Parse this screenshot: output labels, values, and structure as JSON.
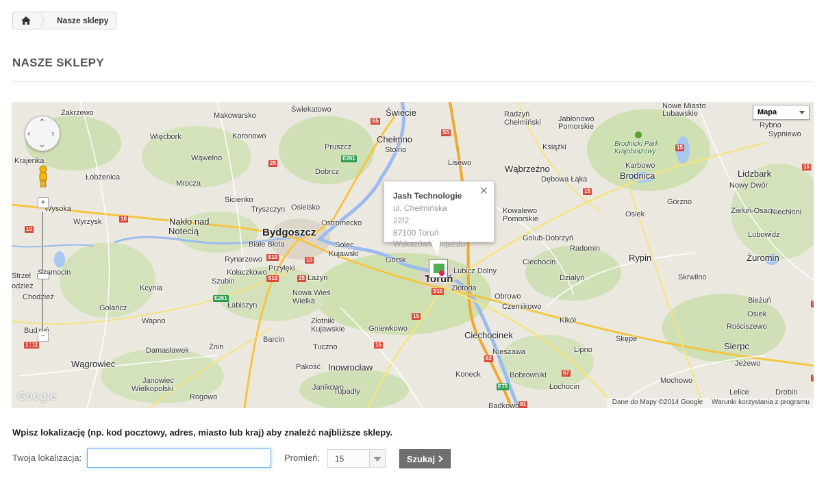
{
  "breadcrumb": {
    "home_icon": "home-icon",
    "current": "Nasze sklepy"
  },
  "page_title": "Nasze sklepy",
  "map": {
    "type_select": "Mapa",
    "info_window": {
      "name": "Jash Technologie",
      "address_line1": "ul. Chełmińska",
      "address_line2": "22/2",
      "address_line3": "87100 Toruń",
      "directions": "Wskazówki dojazdu"
    },
    "google_logo": "Google",
    "attribution": "Dane do Mapy ©2014 Google",
    "terms": "Warunki korzystania z programu",
    "labels": [
      {
        "t": "Zakrzewo",
        "c": "label"
      },
      {
        "t": "Makowarsko",
        "c": "label"
      },
      {
        "t": "Świekatowo",
        "c": "label"
      },
      {
        "t": "Świecie",
        "c": "label town"
      },
      {
        "t": "Radzyń",
        "c": "label"
      },
      {
        "t": "Chełmiński",
        "c": "label"
      },
      {
        "t": "Jabłonowo",
        "c": "label"
      },
      {
        "t": "Pomorskie",
        "c": "label"
      },
      {
        "t": "Nowe Miasto",
        "c": "label"
      },
      {
        "t": "Lubawskie",
        "c": "label"
      },
      {
        "t": "Rybno",
        "c": "label"
      },
      {
        "t": "Sypniewo",
        "c": "label"
      },
      {
        "t": "Więcbork",
        "c": "label"
      },
      {
        "t": "Koronowo",
        "c": "label"
      },
      {
        "t": "Chełmno",
        "c": "label town"
      },
      {
        "t": "Pruszcz",
        "c": "label"
      },
      {
        "t": "Stolno",
        "c": "label"
      },
      {
        "t": "Książki",
        "c": "label"
      },
      {
        "t": "Brodnicki Park",
        "c": "label park"
      },
      {
        "t": "Krajobrazowy",
        "c": "label park"
      },
      {
        "t": "Krajenka",
        "c": "label"
      },
      {
        "t": "Wąwelno",
        "c": "label"
      },
      {
        "t": "Lisewo",
        "c": "label"
      },
      {
        "t": "Wąbrzeźno",
        "c": "label town"
      },
      {
        "t": "Karbowo",
        "c": "label"
      },
      {
        "t": "Łobżenica",
        "c": "label"
      },
      {
        "t": "Mrocza",
        "c": "label"
      },
      {
        "t": "Dobrcz",
        "c": "label"
      },
      {
        "t": "Dębowa Łąka",
        "c": "label"
      },
      {
        "t": "Brodnica",
        "c": "label town"
      },
      {
        "t": "Lidzbark",
        "c": "label town"
      },
      {
        "t": "Nowy Dwór",
        "c": "label"
      },
      {
        "t": "Tryszczyn",
        "c": "label"
      },
      {
        "t": "Sicienko",
        "c": "label"
      },
      {
        "t": "Osielsko",
        "c": "label"
      },
      {
        "t": "Górzno",
        "c": "label"
      },
      {
        "t": "Wysoka",
        "c": "label"
      },
      {
        "t": "Kowalewo",
        "c": "label"
      },
      {
        "t": "Pomorskie",
        "c": "label"
      },
      {
        "t": "Osiek",
        "c": "label"
      },
      {
        "t": "Zieluń-Osada",
        "c": "label"
      },
      {
        "t": "Niechłoni",
        "c": "label"
      },
      {
        "t": "Wyrzysk",
        "c": "label"
      },
      {
        "t": "Nakło nad",
        "c": "label town"
      },
      {
        "t": "Notecią",
        "c": "label town"
      },
      {
        "t": "Ostromecko",
        "c": "label"
      },
      {
        "t": "Bydgoszcz",
        "c": "label city"
      },
      {
        "t": "Golub-Dobrzyń",
        "c": "label"
      },
      {
        "t": "Lubowidz",
        "c": "label"
      },
      {
        "t": "Białe Błota",
        "c": "label"
      },
      {
        "t": "Solec",
        "c": "label"
      },
      {
        "t": "Kujawski",
        "c": "label"
      },
      {
        "t": "Radomin",
        "c": "label"
      },
      {
        "t": "Żuromin",
        "c": "label town"
      },
      {
        "t": "Rynarzewo",
        "c": "label"
      },
      {
        "t": "Górsk",
        "c": "label"
      },
      {
        "t": "Ciechocin",
        "c": "label"
      },
      {
        "t": "Rypin",
        "c": "label town"
      },
      {
        "t": "Przyłęki",
        "c": "label"
      },
      {
        "t": "Lubicz Dolny",
        "c": "label"
      },
      {
        "t": "Szamocin",
        "c": "label"
      },
      {
        "t": "Kołaczkowo",
        "c": "label"
      },
      {
        "t": "Toruń",
        "c": "label city"
      },
      {
        "t": "Strzel",
        "c": "label"
      },
      {
        "t": "odzież",
        "c": "label"
      },
      {
        "t": "Szubin",
        "c": "label"
      },
      {
        "t": "Łażyn",
        "c": "label"
      },
      {
        "t": "Działyń",
        "c": "label"
      },
      {
        "t": "Skrwilno",
        "c": "label"
      },
      {
        "t": "Kcynia",
        "c": "label"
      },
      {
        "t": "Złotoria",
        "c": "label"
      },
      {
        "t": "Obrowo",
        "c": "label"
      },
      {
        "t": "Chodzież",
        "c": "label"
      },
      {
        "t": "Nowa Wieś",
        "c": "label"
      },
      {
        "t": "Wielka",
        "c": "label"
      },
      {
        "t": "Czernikowo",
        "c": "label"
      },
      {
        "t": "Bieżuń",
        "c": "label"
      },
      {
        "t": "Gołańcz",
        "c": "label"
      },
      {
        "t": "Łabiszyn",
        "c": "label"
      },
      {
        "t": "Osiek",
        "c": "label"
      },
      {
        "t": "Wapno",
        "c": "label"
      },
      {
        "t": "Złotniki",
        "c": "label"
      },
      {
        "t": "Kujawskie",
        "c": "label"
      },
      {
        "t": "Kikół",
        "c": "label"
      },
      {
        "t": "Rościszewo",
        "c": "label"
      },
      {
        "t": "Budzyń",
        "c": "label"
      },
      {
        "t": "Gniewkowo",
        "c": "label"
      },
      {
        "t": "Ciechocinek",
        "c": "label town"
      },
      {
        "t": "Skępe",
        "c": "label"
      },
      {
        "t": "Barcin",
        "c": "label"
      },
      {
        "t": "Sierpc",
        "c": "label town"
      },
      {
        "t": "Damasławek",
        "c": "label"
      },
      {
        "t": "Żnin",
        "c": "label"
      },
      {
        "t": "Tuczno",
        "c": "label"
      },
      {
        "t": "Nieszawa",
        "c": "label"
      },
      {
        "t": "Lipno",
        "c": "label"
      },
      {
        "t": "Wągrowiec",
        "c": "label town"
      },
      {
        "t": "Pakość",
        "c": "label"
      },
      {
        "t": "Inowrocław",
        "c": "label town"
      },
      {
        "t": "Jeżewo",
        "c": "label"
      },
      {
        "t": "Koneck",
        "c": "label"
      },
      {
        "t": "Bobrowniki",
        "c": "label"
      },
      {
        "t": "Janowiec",
        "c": "label"
      },
      {
        "t": "Wielkopolski",
        "c": "label"
      },
      {
        "t": "Mochowo",
        "c": "label"
      },
      {
        "t": "Janikowo",
        "c": "label"
      },
      {
        "t": "Tupadły",
        "c": "label"
      },
      {
        "t": "Łochocin",
        "c": "label"
      },
      {
        "t": "Rogowo",
        "c": "label"
      },
      {
        "t": "Lelice",
        "c": "label"
      },
      {
        "t": "Drobin",
        "c": "label"
      },
      {
        "t": "Bądkowo",
        "c": "label"
      }
    ],
    "shields": [
      {
        "t": "S5",
        "c": "red"
      },
      {
        "t": "S5",
        "c": "red"
      },
      {
        "t": "15",
        "c": "red"
      },
      {
        "t": "E261",
        "c": "green"
      },
      {
        "t": "25",
        "c": "red"
      },
      {
        "t": "15",
        "c": "red"
      },
      {
        "t": "S10",
        "c": "red"
      },
      {
        "t": "10",
        "c": "red"
      },
      {
        "t": "S10",
        "c": "red"
      },
      {
        "t": "10",
        "c": "red"
      },
      {
        "t": "25",
        "c": "red"
      },
      {
        "t": "S10",
        "c": "red"
      },
      {
        "t": "10",
        "c": "red"
      },
      {
        "t": "E261",
        "c": "green"
      },
      {
        "t": "15",
        "c": "red"
      },
      {
        "t": "15",
        "c": "red"
      },
      {
        "t": "15",
        "c": "red"
      },
      {
        "t": "10",
        "c": "red"
      },
      {
        "t": "11",
        "c": "red"
      },
      {
        "t": "67",
        "c": "red"
      },
      {
        "t": "62",
        "c": "red"
      },
      {
        "t": "E75",
        "c": "green"
      },
      {
        "t": "91",
        "c": "red"
      },
      {
        "t": "15",
        "c": "red"
      },
      {
        "t": "10",
        "c": "red"
      },
      {
        "t": "10",
        "c": "red"
      }
    ]
  },
  "form": {
    "hint": "Wpisz lokalizację (np. kod pocztowy, adres, miasto lub kraj) aby znaleźć najbliższe sklepy.",
    "location_label": "Twoja lokalizacja:",
    "location_value": "",
    "radius_label": "Promień:",
    "radius_value": "15",
    "search_button": "Szukaj"
  }
}
